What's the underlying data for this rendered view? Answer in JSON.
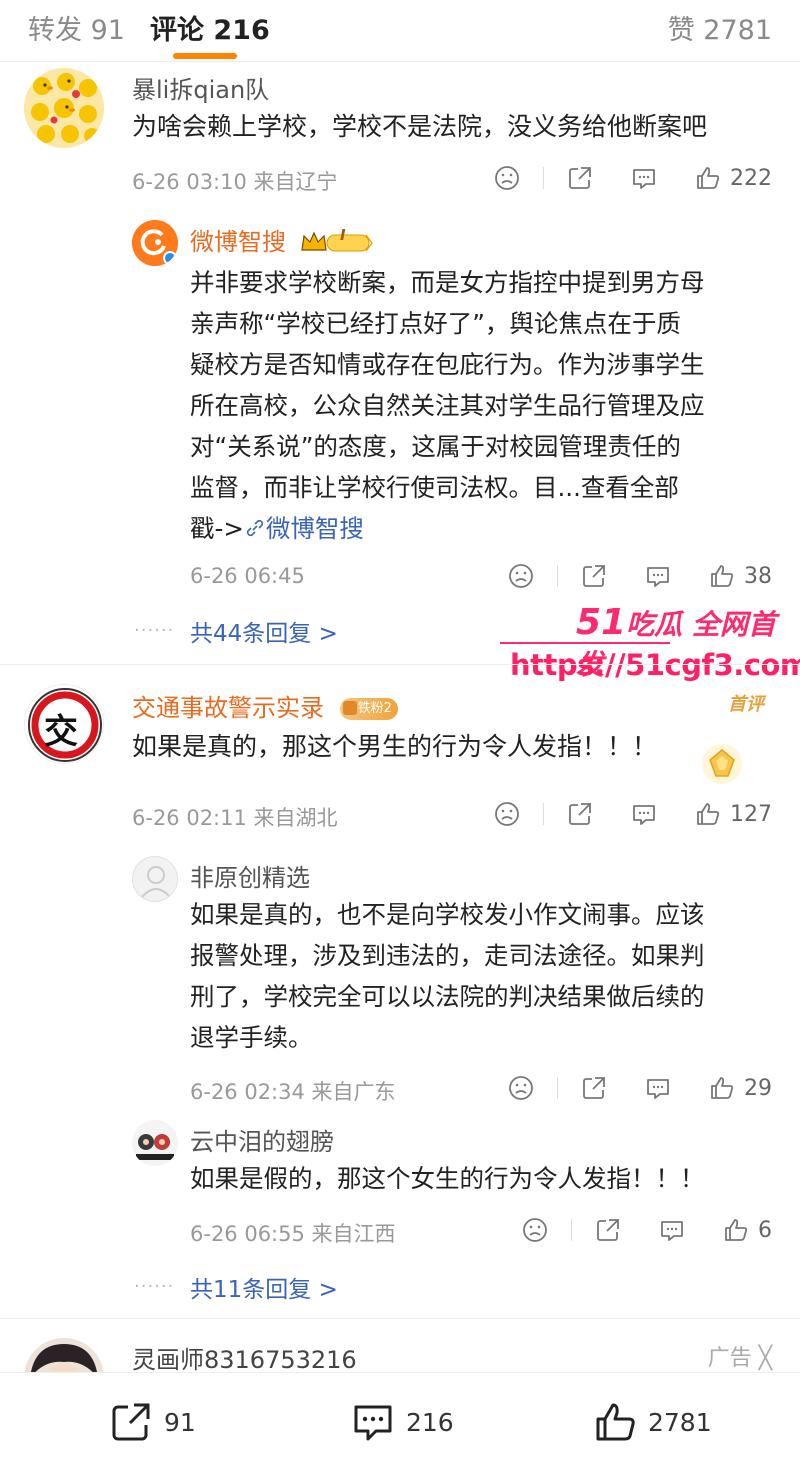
{
  "tabs": {
    "reposts": "转发 91",
    "comments": "评论 216",
    "likes": "赞 2781"
  },
  "comment1": {
    "username": "暴li拆qian队",
    "text": "为啥会赖上学校，学校不是法院，没义务给他断案吧",
    "meta": "6-26 03:10 来自辽宁",
    "likes": "222",
    "reply": {
      "username": "微博智搜",
      "vip_level": "I",
      "lines": [
        "并非要求学校断案，而是女方指控中提到男方母",
        "亲声称“学校已经打点好了”，舆论焦点在于质",
        "疑校方是否知情或存在包庇行为。作为涉事学生",
        "所在高校，公众自然关注其对学生品行管理及应",
        "对“关系说”的态度，这属于对校园管理责任的",
        "监督，而非让学校行使司法权。目...查看全部"
      ],
      "last_prefix": "戳->",
      "last_link": "微博智搜",
      "meta": "6-26 06:45",
      "likes": "38"
    },
    "more_replies": "共44条回复 >"
  },
  "watermark": {
    "num": "51",
    "brand": "吃瓜 全网首发",
    "url": "https://51cgf3.com"
  },
  "comment2": {
    "username": "交通事故警示实录",
    "avatar_char": "交",
    "fan_badge": "铁粉2",
    "first_tag": "首评",
    "text": "如果是真的，那这个男生的行为令人发指！！！",
    "meta": "6-26 02:11 来自湖北",
    "likes": "127",
    "reply1": {
      "username": "非原创精选",
      "lines": [
        "如果是真的，也不是向学校发小作文闹事。应该",
        "报警处理，涉及到违法的，走司法途径。如果判",
        "刑了，学校完全可以以法院的判决结果做后续的",
        "退学手续。"
      ],
      "meta": "6-26 02:34 来自广东",
      "likes": "29"
    },
    "reply2": {
      "username": "云中泪的翅膀",
      "text": "如果是假的，那这个女生的行为令人发指！！！",
      "meta": "6-26 06:55 来自江西",
      "likes": "6"
    },
    "more_replies": "共11条回复 >"
  },
  "comment3": {
    "username": "灵画师8316753216",
    "ad_label": "广告 ╳"
  },
  "bottombar": {
    "reposts": "91",
    "comments": "216",
    "likes": "2781"
  },
  "colors": {
    "accent": "#ff8200",
    "link": "#3a64b8",
    "watermark": "#ff2a6e"
  }
}
